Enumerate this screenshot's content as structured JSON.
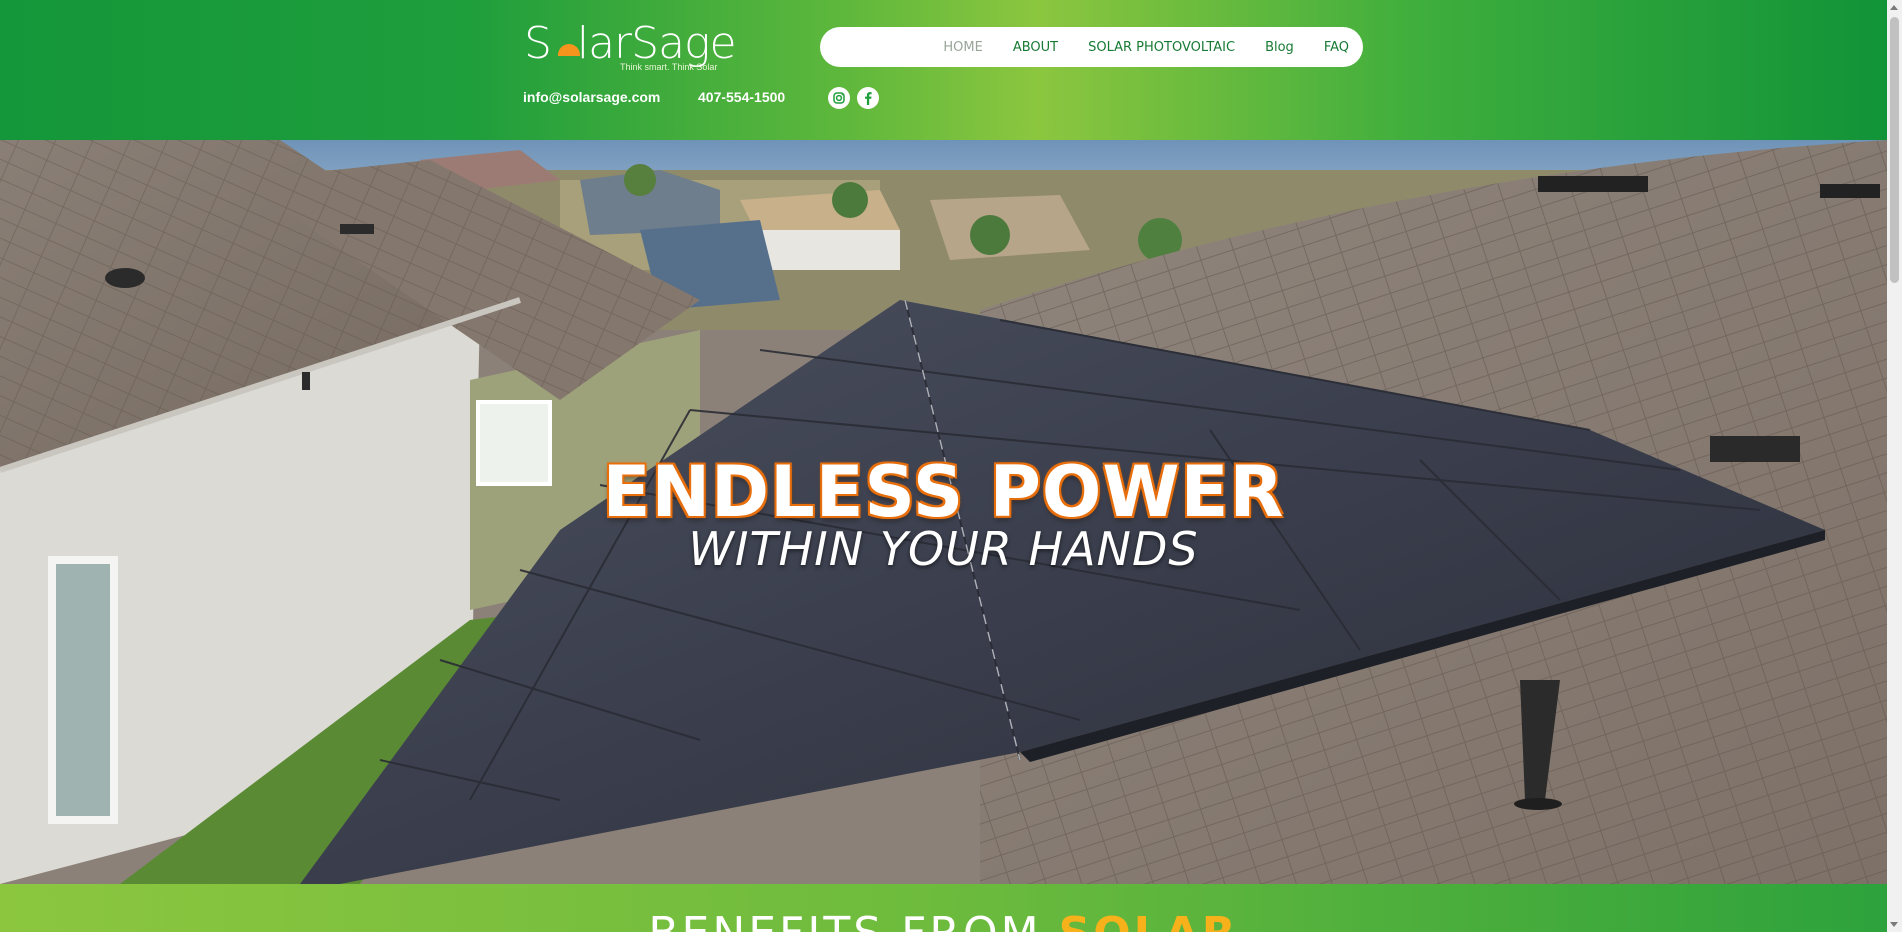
{
  "brand": {
    "name_part1": "S",
    "name_part2": "lar",
    "name_part3": "Sage",
    "tagline": "Think smart. Think Solar"
  },
  "nav": {
    "items": [
      {
        "label": "HOME",
        "active": true
      },
      {
        "label": "ABOUT"
      },
      {
        "label": "SOLAR PHOTOVOLTAIC"
      },
      {
        "label": "Blog"
      },
      {
        "label": "FAQ"
      }
    ]
  },
  "contact": {
    "email": "info@solarsage.com",
    "phone": "407-554-1500"
  },
  "social": {
    "icons": [
      "instagram-icon",
      "facebook-icon"
    ]
  },
  "hero": {
    "title": "ENDLESS POWER",
    "subtitle": "WITHIN YOUR HANDS"
  },
  "benefits": {
    "title_part1": "BENEFITS FROM ",
    "title_part2": "SOLAR"
  },
  "colors": {
    "brand_green": "#14973a",
    "light_green": "#8cc63f",
    "accent_orange": "#e86f0c",
    "accent_yellow": "#f7b21b"
  }
}
